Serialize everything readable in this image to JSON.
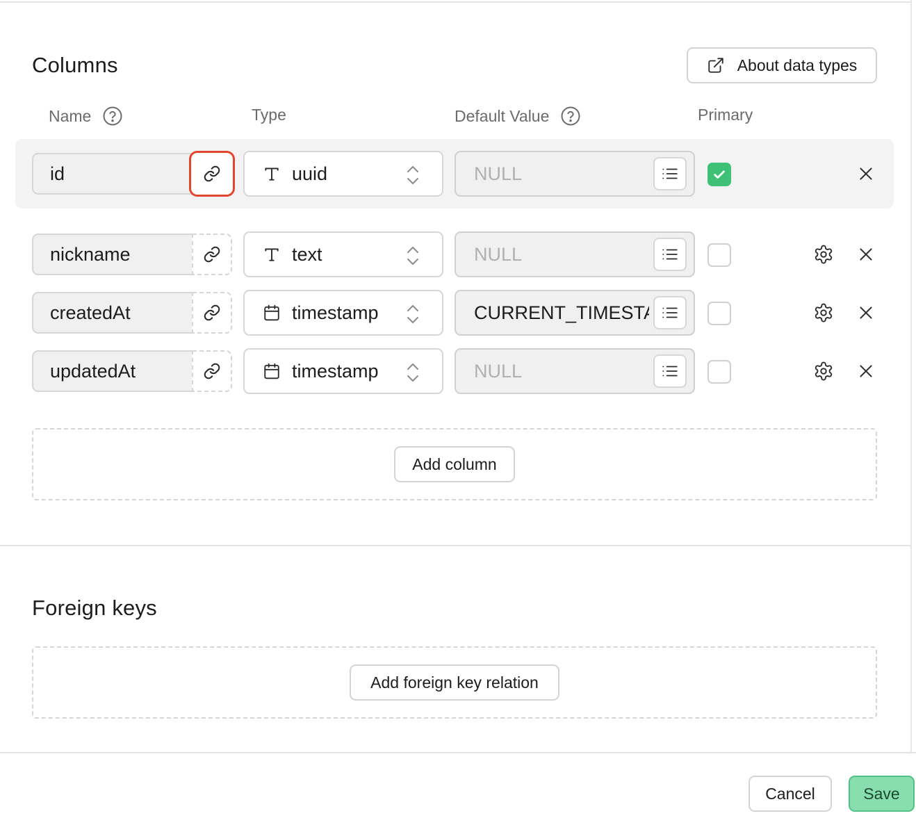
{
  "columns_section": {
    "title": "Columns",
    "about_button": "About data types",
    "headers": {
      "name": "Name",
      "type": "Type",
      "default_value": "Default Value",
      "primary": "Primary"
    },
    "rows": [
      {
        "name": "id",
        "type": "uuid",
        "type_icon": "text-type-icon",
        "default": "NULL",
        "default_is_placeholder": true,
        "primary": true,
        "link_active": true
      },
      {
        "name": "nickname",
        "type": "text",
        "type_icon": "text-type-icon",
        "default": "NULL",
        "default_is_placeholder": true,
        "primary": false
      },
      {
        "name": "createdAt",
        "type": "timestamp",
        "type_icon": "calendar-icon",
        "default": "CURRENT_TIMESTAMP",
        "default_is_placeholder": false,
        "primary": false
      },
      {
        "name": "updatedAt",
        "type": "timestamp",
        "type_icon": "calendar-icon",
        "default": "NULL",
        "default_is_placeholder": true,
        "primary": false
      }
    ],
    "add_column_button": "Add column"
  },
  "foreign_keys_section": {
    "title": "Foreign keys",
    "add_relation_button": "Add foreign key relation"
  },
  "footer": {
    "cancel_label": "Cancel",
    "save_label": "Save"
  },
  "colors": {
    "accent_green": "#3ec177",
    "save_bg": "#88deae",
    "highlight_red": "#e0452f"
  }
}
